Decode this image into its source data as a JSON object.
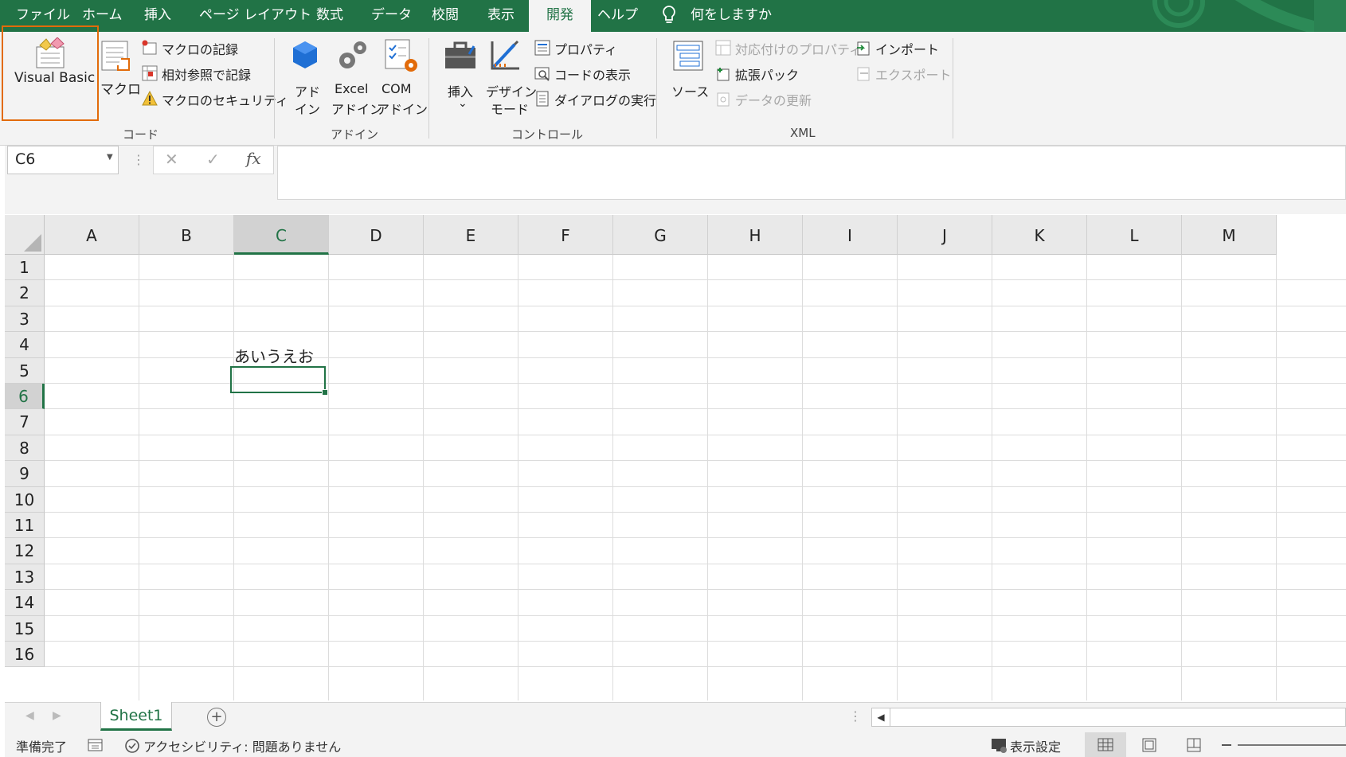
{
  "tabs": [
    "ファイル",
    "ホーム",
    "挿入",
    "ページ レイアウト",
    "数式",
    "データ",
    "校閲",
    "表示",
    "開発",
    "ヘルプ"
  ],
  "active_tab": "開発",
  "tell_me": "何をしますか",
  "ribbon": {
    "code": {
      "visual_basic": "Visual Basic",
      "macro": "マクロ",
      "record_macro": "マクロの記録",
      "relative_ref": "相対参照で記録",
      "macro_security": "マクロのセキュリティ",
      "group": "コード"
    },
    "addins": {
      "addin_1": "アド",
      "addin_2": "イン",
      "excel_1": "Excel",
      "excel_2": "アドイン",
      "com_1": "COM",
      "com_2": "アドイン",
      "group": "アドイン"
    },
    "controls": {
      "insert": "挿入",
      "insert_arrow": "⌄",
      "design_1": "デザイン",
      "design_2": "モード",
      "properties": "プロパティ",
      "view_code": "コードの表示",
      "run_dialog": "ダイアログの実行",
      "group": "コントロール"
    },
    "xml": {
      "source": "ソース",
      "map_props": "対応付けのプロパティ",
      "expansion": "拡張パック",
      "refresh": "データの更新",
      "import": "インポート",
      "export": "エクスポート",
      "group": "XML"
    }
  },
  "formula_bar": {
    "name_box": "C6",
    "cancel": "✕",
    "enter": "✓",
    "fx": "fx",
    "value": ""
  },
  "grid": {
    "columns": [
      "A",
      "B",
      "C",
      "D",
      "E",
      "F",
      "G",
      "H",
      "I",
      "J",
      "K",
      "L",
      "M"
    ],
    "rows": [
      "1",
      "2",
      "3",
      "4",
      "5",
      "6",
      "7",
      "8",
      "9",
      "10",
      "11",
      "12",
      "13",
      "14",
      "15",
      "16"
    ],
    "selected_cell": "C6",
    "cells": {
      "C5": "あいうえお"
    }
  },
  "sheets": {
    "active": "Sheet1",
    "add": "+"
  },
  "status": {
    "ready": "準備完了",
    "accessibility": "アクセシビリティ: 問題ありません",
    "display_settings": "表示設定"
  },
  "colors": {
    "accent": "#217346",
    "highlight": "#e26b0a"
  }
}
